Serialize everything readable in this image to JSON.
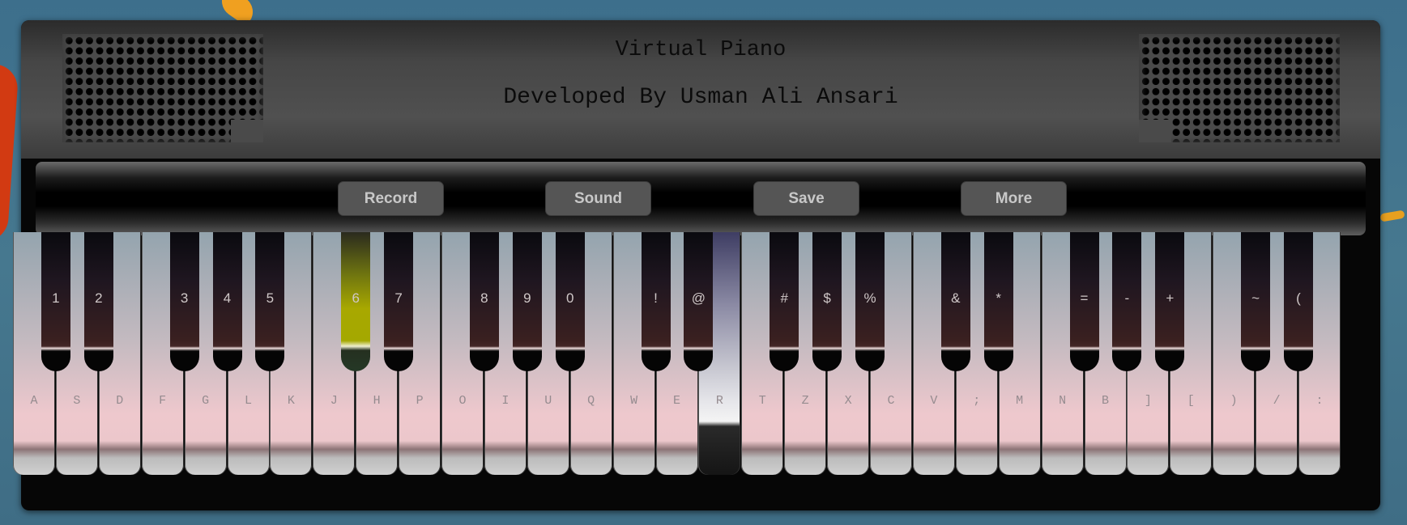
{
  "header": {
    "title": "Virtual Piano",
    "subtitle": "Developed By Usman Ali Ansari"
  },
  "controls": {
    "record": "Record",
    "sound": "Sound",
    "save": "Save",
    "more": "More"
  },
  "white_keys": [
    "A",
    "S",
    "D",
    "F",
    "G",
    "L",
    "K",
    "J",
    "H",
    "P",
    "O",
    "I",
    "U",
    "Q",
    "W",
    "E",
    "R",
    "T",
    "Z",
    "X",
    "C",
    "V",
    ";",
    "M",
    "N",
    "B",
    "]",
    "[",
    ")",
    "/",
    ":"
  ],
  "black_keys": [
    "1",
    "2",
    "3",
    "4",
    "5",
    "6",
    "7",
    "8",
    "9",
    "0",
    "!",
    "@",
    "#",
    "$",
    "%",
    "&",
    "*",
    "=",
    "-",
    "+",
    "~",
    "("
  ],
  "active_keys": {
    "white": "R",
    "black": "6"
  },
  "colors": {
    "background": "#46788f",
    "button": "#555555",
    "button_text": "#c8c8c8",
    "active_black_key": "#a8a800",
    "active_white_key": "#3e3d63"
  }
}
